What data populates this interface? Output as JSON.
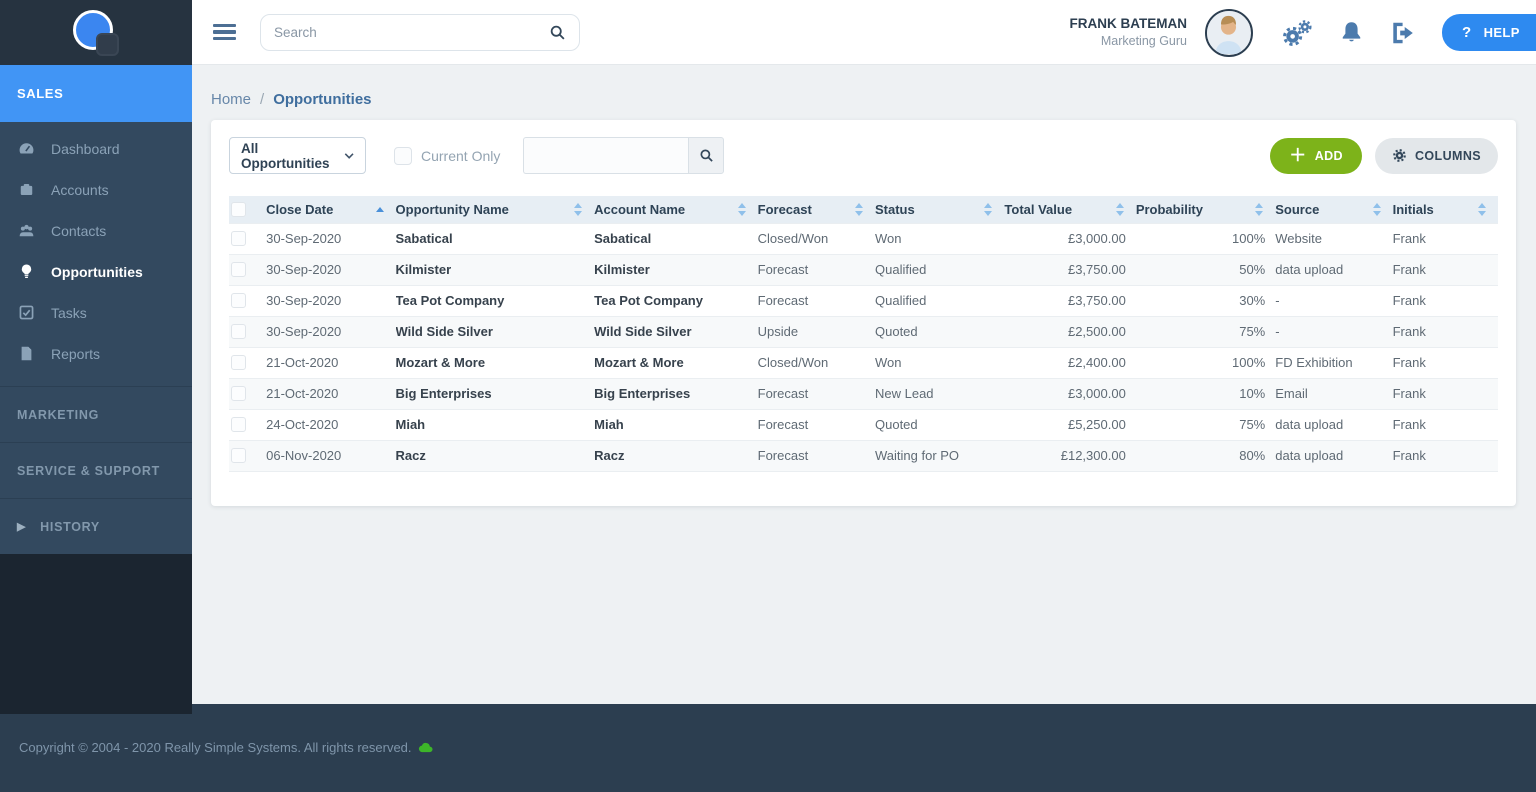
{
  "colors": {
    "accent_blue": "#4195f5",
    "help_blue": "#2e8af0",
    "add_green": "#7db31a",
    "sidebar_bg": "#33495f",
    "sidebar_dark": "#1b2530",
    "footer_bg": "#2c3e50",
    "table_header_bg": "#e7eef4"
  },
  "topbar": {
    "search_placeholder": "Search",
    "user_name": "FRANK BATEMAN",
    "user_role": "Marketing Guru",
    "help_label": "HELP",
    "help_icon": "question-mark-icon",
    "icons": [
      "gears-icon",
      "bell-icon",
      "sign-out-icon"
    ]
  },
  "sidebar": {
    "active_section_label": "SALES",
    "items": [
      {
        "label": "Dashboard",
        "icon": "gauge-icon",
        "active": false
      },
      {
        "label": "Accounts",
        "icon": "briefcase-icon",
        "active": false
      },
      {
        "label": "Contacts",
        "icon": "users-icon",
        "active": false
      },
      {
        "label": "Opportunities",
        "icon": "lightbulb-icon",
        "active": true
      },
      {
        "label": "Tasks",
        "icon": "check-square-icon",
        "active": false
      },
      {
        "label": "Reports",
        "icon": "report-icon",
        "active": false
      }
    ],
    "sections": [
      {
        "label": "MARKETING"
      },
      {
        "label": "SERVICE & SUPPORT"
      },
      {
        "label": "HISTORY",
        "icon": "caret-right-icon"
      }
    ]
  },
  "breadcrumb": {
    "home": "Home",
    "separator": "/",
    "current": "Opportunities"
  },
  "toolbar": {
    "filter_value": "All Opportunities",
    "current_only_label": "Current Only",
    "search_value": "",
    "add_label": "ADD",
    "columns_label": "COLUMNS"
  },
  "table": {
    "sort_column": "Close Date",
    "sort_direction": "ascending",
    "columns": [
      {
        "label": "Close Date",
        "sort": "asc",
        "align": "left"
      },
      {
        "label": "Opportunity Name",
        "sort": "both",
        "align": "left"
      },
      {
        "label": "Account Name",
        "sort": "both",
        "align": "left"
      },
      {
        "label": "Forecast",
        "sort": "both",
        "align": "left"
      },
      {
        "label": "Status",
        "sort": "both",
        "align": "left"
      },
      {
        "label": "Total Value",
        "sort": "both",
        "align": "right"
      },
      {
        "label": "Probability",
        "sort": "both",
        "align": "right"
      },
      {
        "label": "Source",
        "sort": "both",
        "align": "left"
      },
      {
        "label": "Initials",
        "sort": "both",
        "align": "left"
      }
    ],
    "rows": [
      {
        "close_date": "30-Sep-2020",
        "opportunity": "Sabatical",
        "account": "Sabatical",
        "forecast": "Closed/Won",
        "status": "Won",
        "total_value": "£3,000.00",
        "probability": "100%",
        "source": "Website",
        "initials": "Frank"
      },
      {
        "close_date": "30-Sep-2020",
        "opportunity": "Kilmister",
        "account": "Kilmister",
        "forecast": "Forecast",
        "status": "Qualified",
        "total_value": "£3,750.00",
        "probability": "50%",
        "source": "data upload",
        "initials": "Frank"
      },
      {
        "close_date": "30-Sep-2020",
        "opportunity": "Tea Pot Company",
        "account": "Tea Pot Company",
        "forecast": "Forecast",
        "status": "Qualified",
        "total_value": "£3,750.00",
        "probability": "30%",
        "source": "-",
        "initials": "Frank"
      },
      {
        "close_date": "30-Sep-2020",
        "opportunity": "Wild Side Silver",
        "account": "Wild Side Silver",
        "forecast": "Upside",
        "status": "Quoted",
        "total_value": "£2,500.00",
        "probability": "75%",
        "source": "-",
        "initials": "Frank"
      },
      {
        "close_date": "21-Oct-2020",
        "opportunity": "Mozart & More",
        "account": "Mozart & More",
        "forecast": "Closed/Won",
        "status": "Won",
        "total_value": "£2,400.00",
        "probability": "100%",
        "source": "FD Exhibition",
        "initials": "Frank"
      },
      {
        "close_date": "21-Oct-2020",
        "opportunity": "Big Enterprises",
        "account": "Big Enterprises",
        "forecast": "Forecast",
        "status": "New Lead",
        "total_value": "£3,000.00",
        "probability": "10%",
        "source": "Email",
        "initials": "Frank"
      },
      {
        "close_date": "24-Oct-2020",
        "opportunity": "Miah",
        "account": "Miah",
        "forecast": "Forecast",
        "status": "Quoted",
        "total_value": "£5,250.00",
        "probability": "75%",
        "source": "data upload",
        "initials": "Frank"
      },
      {
        "close_date": "06-Nov-2020",
        "opportunity": "Racz",
        "account": "Racz",
        "forecast": "Forecast",
        "status": "Waiting for PO",
        "total_value": "£12,300.00",
        "probability": "80%",
        "source": "data upload",
        "initials": "Frank"
      }
    ]
  },
  "footer": {
    "copyright": "Copyright © 2004 - 2020 Really Simple Systems. All rights reserved.",
    "icon": "green-chat-icon"
  }
}
